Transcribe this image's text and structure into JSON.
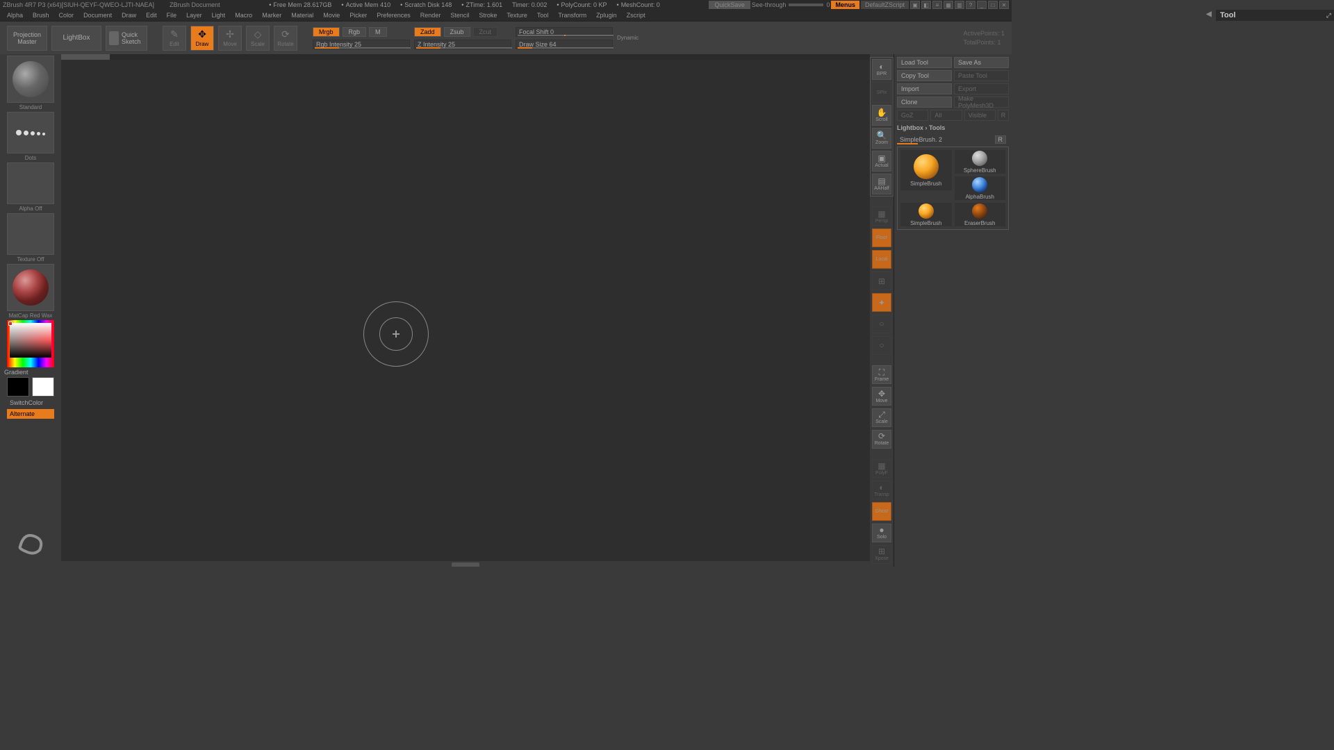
{
  "title": {
    "app": "ZBrush 4R7 P3 (x64)[SIUH-QEYF-QWEO-LJTI-NAEA]",
    "doc": "ZBrush Document"
  },
  "status": {
    "freemem": "Free Mem 28.617GB",
    "activemem": "Active Mem 410",
    "scratch": "Scratch Disk 148",
    "ztime": "ZTime: 1.601",
    "timer": "Timer: 0.002",
    "polycount": "PolyCount: 0 KP",
    "meshcount": "MeshCount: 0"
  },
  "titlebar_right": {
    "quicksave": "QuickSave",
    "seethrough": "See-through",
    "seethrough_val": "0",
    "menus": "Menus",
    "defaultscript": "DefaultZScript"
  },
  "menus": [
    "Alpha",
    "Brush",
    "Color",
    "Document",
    "Draw",
    "Edit",
    "File",
    "Layer",
    "Light",
    "Macro",
    "Marker",
    "Material",
    "Movie",
    "Picker",
    "Preferences",
    "Render",
    "Stencil",
    "Stroke",
    "Texture",
    "Tool",
    "Transform",
    "Zplugin",
    "Zscript"
  ],
  "shelf": {
    "projection": "Projection",
    "master": "Master",
    "lightbox": "LightBox",
    "quicksketch_l1": "Quick",
    "quicksketch_l2": "Sketch",
    "modes": {
      "edit": "Edit",
      "draw": "Draw",
      "move": "Move",
      "scale": "Scale",
      "rotate": "Rotate"
    },
    "channels": {
      "mrgb": "Mrgb",
      "rgb": "Rgb",
      "m": "M",
      "zadd": "Zadd",
      "zsub": "Zsub",
      "zcut": "Zcut"
    },
    "sliders": {
      "rgb_intensity": "Rgb Intensity 25",
      "z_intensity": "Z Intensity 25",
      "focal_shift": "Focal Shift 0",
      "draw_size": "Draw Size 64"
    },
    "dynamic": "Dynamic",
    "activepoints": "ActivePoints: 1",
    "totalpoints": "TotalPoints: 1"
  },
  "lefttray": {
    "brush": "Standard",
    "stroke": "Dots",
    "alpha": "Alpha Off",
    "texture": "Texture Off",
    "material": "MatCap Red Wax",
    "gradient": "Gradient",
    "switchcolor": "SwitchColor",
    "alternate": "Alternate"
  },
  "rightdock": {
    "bpr": "BPR",
    "spix": "SPix",
    "scroll": "Scroll",
    "zoom": "Zoom",
    "actual": "Actual",
    "aahalf": "AAHalf",
    "persp": "Persp",
    "floor": "Floor",
    "local": "Local",
    "frame": "Frame",
    "move": "Move",
    "scale": "Scale",
    "rotate": "Rotate",
    "polyf": "PolyF",
    "transp": "Transp",
    "ghost": "Ghost",
    "solo": "Solo",
    "xpose": "Xpose"
  },
  "toolpanel": {
    "title": "Tool",
    "loadtool": "Load Tool",
    "saveas": "Save As",
    "copytool": "Copy Tool",
    "pastetool": "Paste Tool",
    "import": "Import",
    "export": "Export",
    "clone": "Clone",
    "polymesh": "Make PolyMesh3D",
    "goz": "GoZ",
    "all": "All",
    "visible": "Visible",
    "r": "R",
    "lightbox_tools": "Lightbox › Tools",
    "simplebrush": "SimpleBrush. 2",
    "thumbs": {
      "simplebrush_l": "SimpleBrush",
      "spherebrush": "SphereBrush",
      "alphabrush": "AlphaBrush",
      "simplebrush2": "SimpleBrush",
      "eraserbrush": "EraserBrush"
    }
  }
}
